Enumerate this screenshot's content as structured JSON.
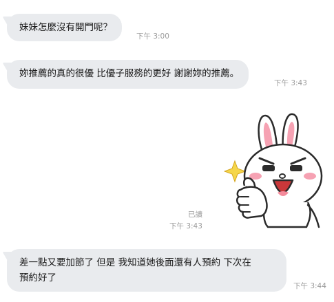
{
  "messages": [
    {
      "text": "妹妹怎麼沒有開門呢？",
      "time": "下午 3:00"
    },
    {
      "text": "妳推薦的真的很優 比優子服務的更好 謝謝妳的推薦。",
      "time": "下午 3:43"
    },
    {
      "sticker": "cony-thumbs-up-sticker",
      "read": "已讀",
      "time": "下午 3:43"
    },
    {
      "text": "差一點又要加節了 但是 我知道她後面還有人預約 下次在\n預約好了",
      "time": "下午 3:44"
    }
  ],
  "colors": {
    "incoming_bubble": "#e9ebee",
    "meta_text": "#9a9a9a",
    "message_text": "#1a1a1a",
    "sticker_ear_pink": "#f6a2b3",
    "sticker_sparkle": "#f5d64a"
  }
}
